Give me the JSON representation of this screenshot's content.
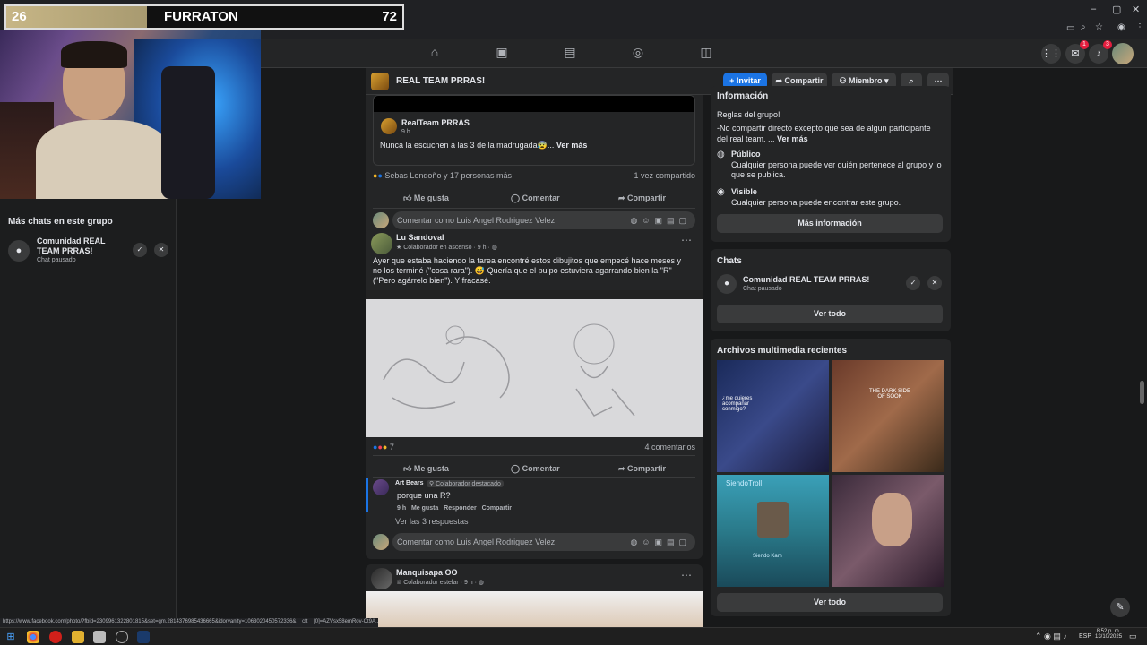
{
  "overlay": {
    "left_score": "26",
    "name": "FURRATON",
    "right_score": "72"
  },
  "left_panel": {
    "heading": "Más chats en este grupo",
    "chat_name": "Comunidad REAL TEAM PRRAS!",
    "chat_status": "Chat pausado"
  },
  "group": {
    "name": "REAL TEAM PRRAS!",
    "invite": "+ Invitar",
    "share": "Compartir",
    "member": "Miembro"
  },
  "shared_post": {
    "author": "RealTeam PRRAS",
    "time": "9 h",
    "text": "Nunca la escuchen a las 3 de la madrugada😰...",
    "more": "Ver más",
    "reactions": "Sebas Londoño y 17 personas más",
    "shares": "1 vez compartido"
  },
  "actions": {
    "like": "Me gusta",
    "comment": "Comentar",
    "share": "Compartir"
  },
  "comment_placeholder": "Comentar como Luis Angel Rodriguez Velez",
  "post2": {
    "author": "Lu Sandoval",
    "badge": "Colaborador en ascenso",
    "time": "9 h",
    "text": "Ayer que estaba haciendo la tarea encontré estos dibujitos que empecé hace meses y no los terminé (\"cosa rara\"). 😅 Quería que el pulpo estuviera agarrando bien la \"R\" (\"Pero agárrelo bien\"). Y fracasé.",
    "reactions": "7",
    "comments": "4 comentarios"
  },
  "comment": {
    "author": "Art Bears",
    "badge": "Colaborador destacado",
    "text": "porque una R?",
    "time": "9 h",
    "like": "Me gusta",
    "reply": "Responder",
    "share": "Compartir",
    "replies": "Ver las 3 respuestas"
  },
  "post3": {
    "author": "Manquisapa OO",
    "badge": "Colaborador estelar",
    "time": "9 h"
  },
  "info": {
    "heading": "Información",
    "rules_title": "Reglas del grupo!",
    "rules_text": "-No compartir directo excepto que sea de algun participante del real team. ...",
    "rules_more": "Ver más",
    "public_title": "Público",
    "public_text": "Cualquier persona puede ver quién pertenece al grupo y lo que se publica.",
    "visible_title": "Visible",
    "visible_text": "Cualquier persona puede encontrar este grupo.",
    "more_info": "Más información"
  },
  "chats": {
    "heading": "Chats",
    "chat_name": "Comunidad REAL TEAM PRRAS!",
    "chat_status": "Chat pausado",
    "see_all": "Ver todo"
  },
  "media": {
    "heading": "Archivos multimedia recientes",
    "see_all": "Ver todo",
    "t1": "¿me quieres acompañar conmigo?",
    "t2": "THE DARK SIDE OF SOOK",
    "t3": "SiendoTroll",
    "t4": "Siendo Kam"
  },
  "status_url": "https://www.facebook.com/photo/?fbid=2309961322801815&set=gm.2814376985436665&idorvanity=1063020450572336&__cft__[0]=AZVsx58emRov-Ct9A...",
  "tray": {
    "lang": "ESP",
    "time": "8:52 p. m.",
    "date": "13/10/2025"
  },
  "notif_counts": {
    "messenger": "1",
    "bell": "3"
  }
}
